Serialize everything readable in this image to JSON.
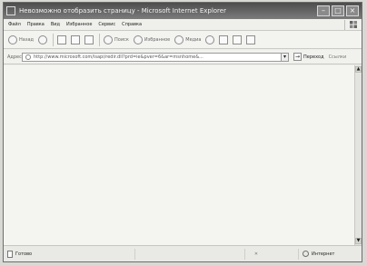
{
  "window": {
    "title": "Невозможно отобразить страницу - Microsoft Internet Explorer"
  },
  "menu": [
    "Файл",
    "Правка",
    "Вид",
    "Избранное",
    "Сервис",
    "Справка"
  ],
  "toolbar": {
    "back": "Назад",
    "search": "Поиск",
    "favorites": "Избранное",
    "media": "Медиа"
  },
  "address": {
    "label": "Адрес",
    "url": "http://www.microsoft.com/isapi/redir.dll?prd=ie&pver=6&ar=msnhome&...",
    "go": "Переход",
    "links": "Ссылки"
  },
  "status": {
    "left": "Готово",
    "right": "Интернет"
  },
  "icons": {
    "back": "back-icon",
    "forward": "forward-icon",
    "stop": "stop-icon",
    "refresh": "refresh-icon",
    "home": "home-icon",
    "search": "search-icon",
    "favorites": "favorites-icon",
    "media": "media-icon",
    "history": "history-icon",
    "mail": "mail-icon",
    "print": "print-icon",
    "edit": "edit-icon",
    "go": "go-icon",
    "page": "page-icon",
    "globe": "globe-icon"
  }
}
